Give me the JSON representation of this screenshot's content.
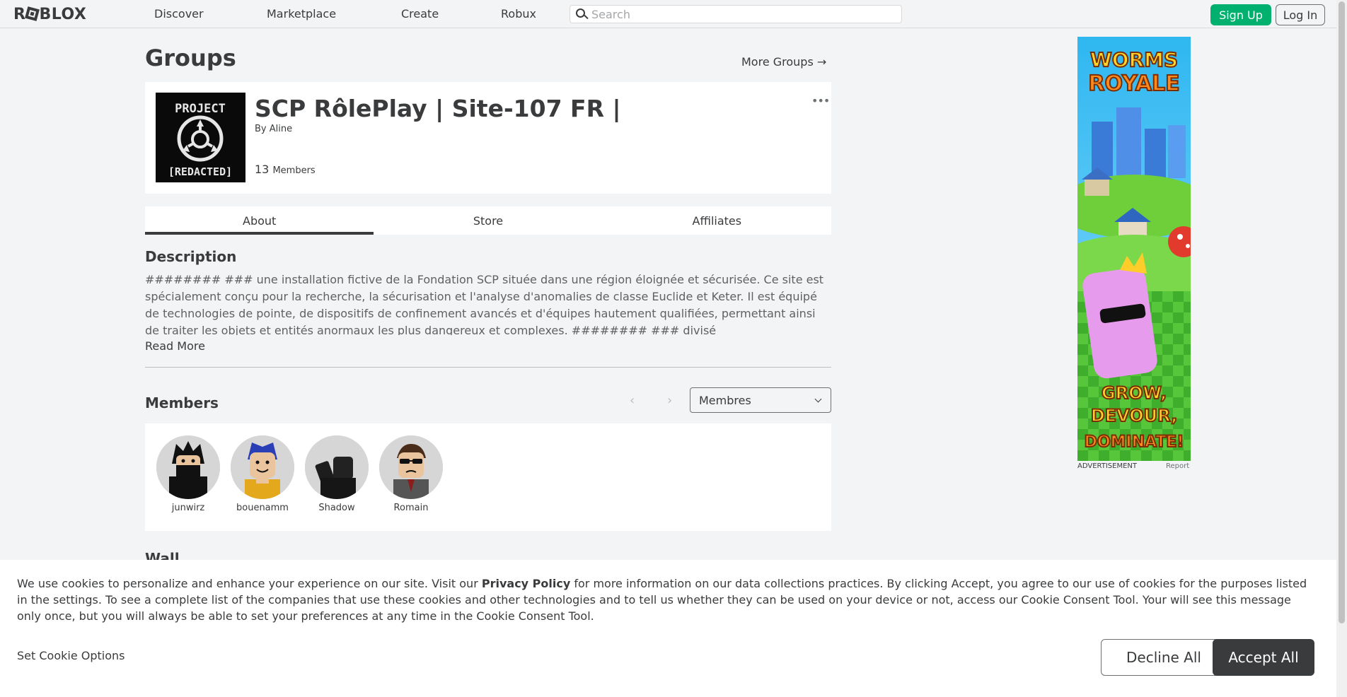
{
  "nav": {
    "logo": "ROBLOX",
    "links": [
      "Discover",
      "Marketplace",
      "Create",
      "Robux"
    ],
    "search_placeholder": "Search",
    "signup": "Sign Up",
    "login": "Log In"
  },
  "page": {
    "title": "Groups",
    "more_groups": "More Groups →"
  },
  "group": {
    "name": "SCP RôlePlay | Site-107 FR |",
    "by_label": "By",
    "owner": "Aline",
    "member_count": "13",
    "member_label": "Members",
    "emblem_text_top": "PROJECT",
    "emblem_text_bottom": "[REDACTED]",
    "more_icon": "•••"
  },
  "tabs": [
    "About",
    "Store",
    "Affiliates"
  ],
  "description": {
    "heading": "Description",
    "text": "######## ### une installation fictive de la Fondation SCP située dans une région éloignée et sécurisée. Ce site est spécialement conçu pour la recherche, la sécurisation et l'analyse d'anomalies de classe Euclide et Keter. Il est équipé de technologies de pointe, de dispositifs de confinement avancés et d'équipes hautement qualifiées, permettant ainsi de traiter les objets et entités anormaux les plus dangereux et complexes. ######## ### divisé",
    "read_more": "Read More"
  },
  "members": {
    "heading": "Members",
    "role_selected": "Membres",
    "list": [
      {
        "name": "junwirz"
      },
      {
        "name": "bouenamm"
      },
      {
        "name": "Shadow"
      },
      {
        "name": "Romain"
      }
    ]
  },
  "wall": {
    "heading": "Wall"
  },
  "ad": {
    "label": "ADVERTISEMENT",
    "report": "Report",
    "title_line1": "WORMS",
    "title_line2": "ROYALE",
    "tagline1": "GROW,",
    "tagline2": "DEVOUR,",
    "tagline3": "DOMINATE!"
  },
  "cookie": {
    "text_1": "We use cookies to personalize and enhance your experience on our site. Visit our ",
    "privacy_link": "Privacy Policy",
    "text_2": " for more information on our data collections practices. By clicking Accept, you agree to our use of cookies for the purposes listed in the settings. To see a complete list of the companies that use these cookies and other technologies and to tell us whether they can be used on your device or not, access our Cookie Consent Tool. Your will see this message only once, but you will always be able to set your preferences at any time in the Cookie Consent Tool.",
    "set_options": "Set Cookie Options",
    "decline": "Decline All",
    "accept": "Accept All"
  },
  "colors": {
    "signup_green": "#00b06f",
    "text_dark": "#393b3d",
    "background": "#f2f4f5"
  }
}
